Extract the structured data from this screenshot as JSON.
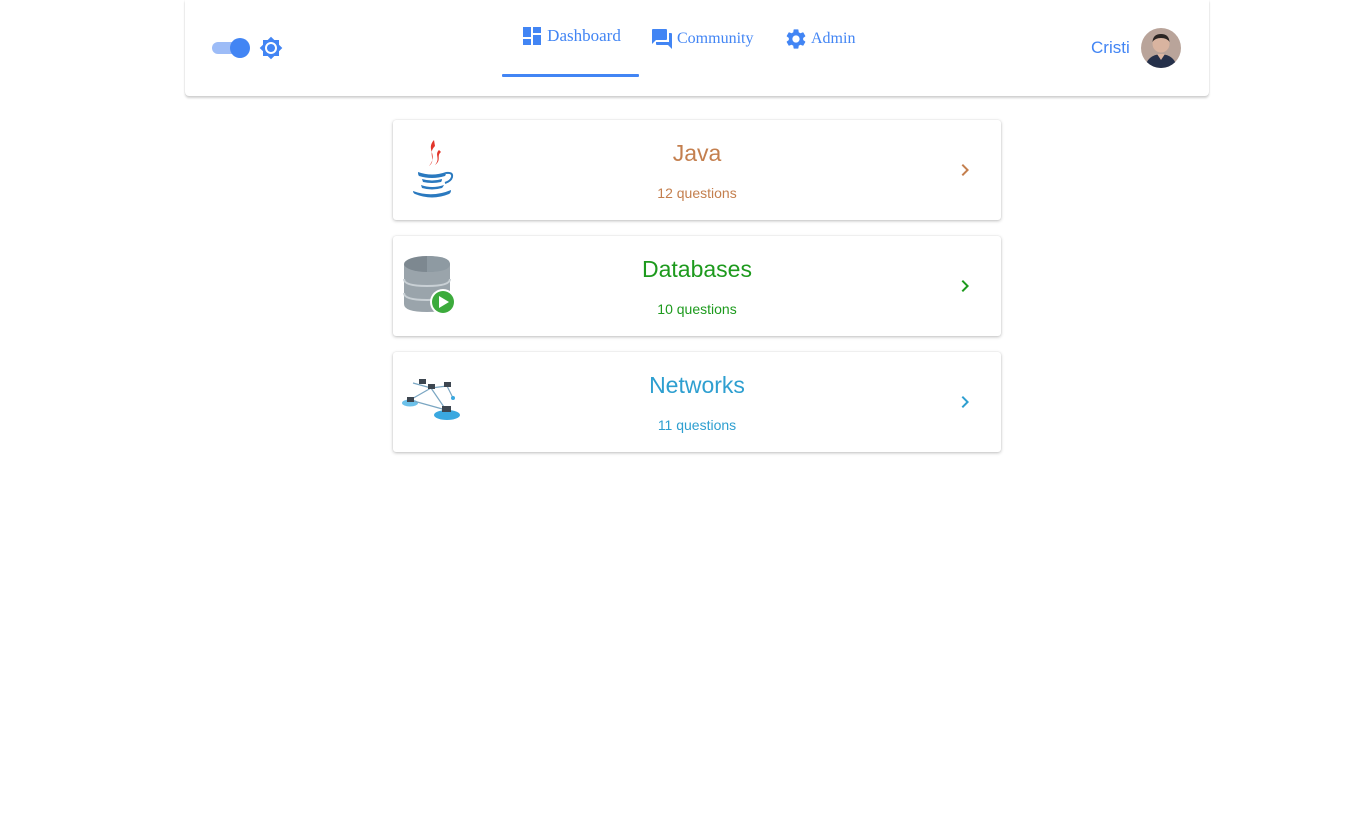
{
  "nav": {
    "tabs": [
      {
        "label": "Dashboard",
        "icon": "dashboard-icon",
        "active": true
      },
      {
        "label": "Community",
        "icon": "forum-icon",
        "active": false
      },
      {
        "label": "Admin",
        "icon": "gear-icon",
        "active": false
      }
    ],
    "user_name": "Cristi",
    "dark_mode_toggle_on": true
  },
  "categories": [
    {
      "title": "Java",
      "count": "12 questions",
      "color": "#c47f4e",
      "icon": "java-logo-icon"
    },
    {
      "title": "Databases",
      "count": "10 questions",
      "color": "#1d9a1d",
      "icon": "database-icon"
    },
    {
      "title": "Networks",
      "count": "11 questions",
      "color": "#2e9fd0",
      "icon": "network-icon"
    }
  ],
  "colors": {
    "accent": "#4285f4",
    "accent_light": "#9dbcf7"
  }
}
